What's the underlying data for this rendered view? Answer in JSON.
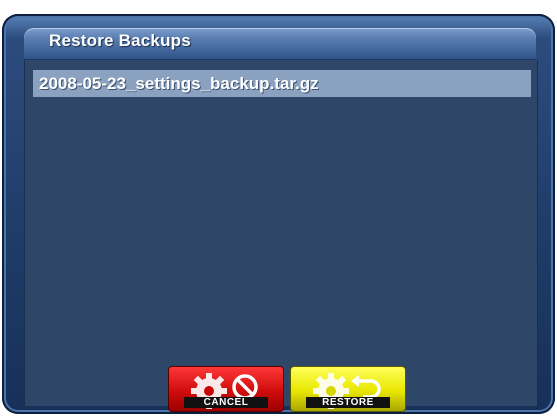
{
  "dialog": {
    "title": "Restore Backups"
  },
  "backups": {
    "items": [
      "2008-05-23_settings_backup.tar.gz"
    ],
    "selected_index": 0
  },
  "buttons": {
    "cancel_label": "CANCEL",
    "restore_label": "RESTORE"
  },
  "colors": {
    "cancel": "#d00c0c",
    "restore": "#e8e600",
    "selection": "#8aa2bf",
    "panel": "#2e4668"
  },
  "icons": {
    "cancel": "gear-with-prohibit-icon",
    "restore": "gear-with-undo-arrow-icon"
  }
}
